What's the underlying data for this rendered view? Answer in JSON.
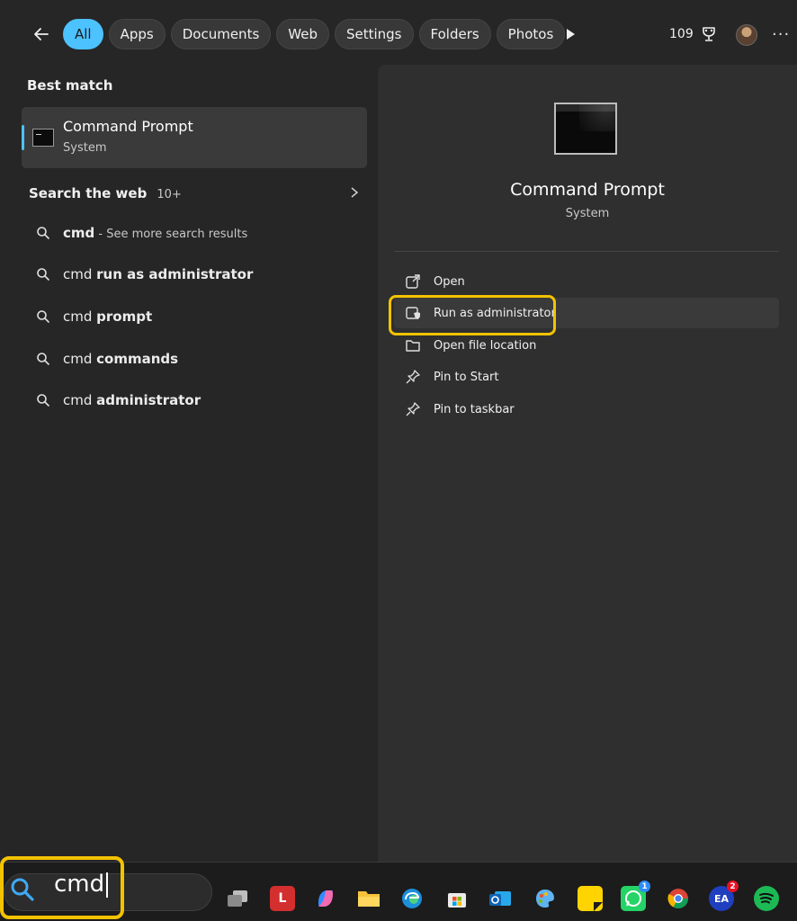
{
  "filters": [
    "All",
    "Apps",
    "Documents",
    "Web",
    "Settings",
    "Folders",
    "Photos"
  ],
  "active_filter": "All",
  "rewards_points": "109",
  "best_match": {
    "title": "Best match",
    "name": "Command Prompt",
    "type": "System"
  },
  "search_web": {
    "title": "Search the web",
    "count": "10+",
    "items": [
      {
        "prefix": "cmd",
        "bold": "",
        "suffix": " - See more search results"
      },
      {
        "prefix": "cmd ",
        "bold": "run as administrator",
        "suffix": ""
      },
      {
        "prefix": "cmd ",
        "bold": "prompt",
        "suffix": ""
      },
      {
        "prefix": "cmd ",
        "bold": "commands",
        "suffix": ""
      },
      {
        "prefix": "cmd ",
        "bold": "administrator",
        "suffix": ""
      }
    ]
  },
  "detail": {
    "name": "Command Prompt",
    "type": "System",
    "actions": [
      "Open",
      "Run as administrator",
      "Open file location",
      "Pin to Start",
      "Pin to taskbar"
    ]
  },
  "taskbar": {
    "search_value": "cmd",
    "apps": [
      "task-view",
      "lastpass",
      "copilot",
      "file-explorer",
      "edge",
      "microsoft-store",
      "outlook",
      "paint",
      "sticky-notes",
      "whatsapp",
      "chrome",
      "ea",
      "spotify"
    ],
    "whatsapp_badge": "1",
    "ea_badge": "2"
  },
  "colors": {
    "accent": "#4cc2ff",
    "highlight": "#f3c300"
  }
}
